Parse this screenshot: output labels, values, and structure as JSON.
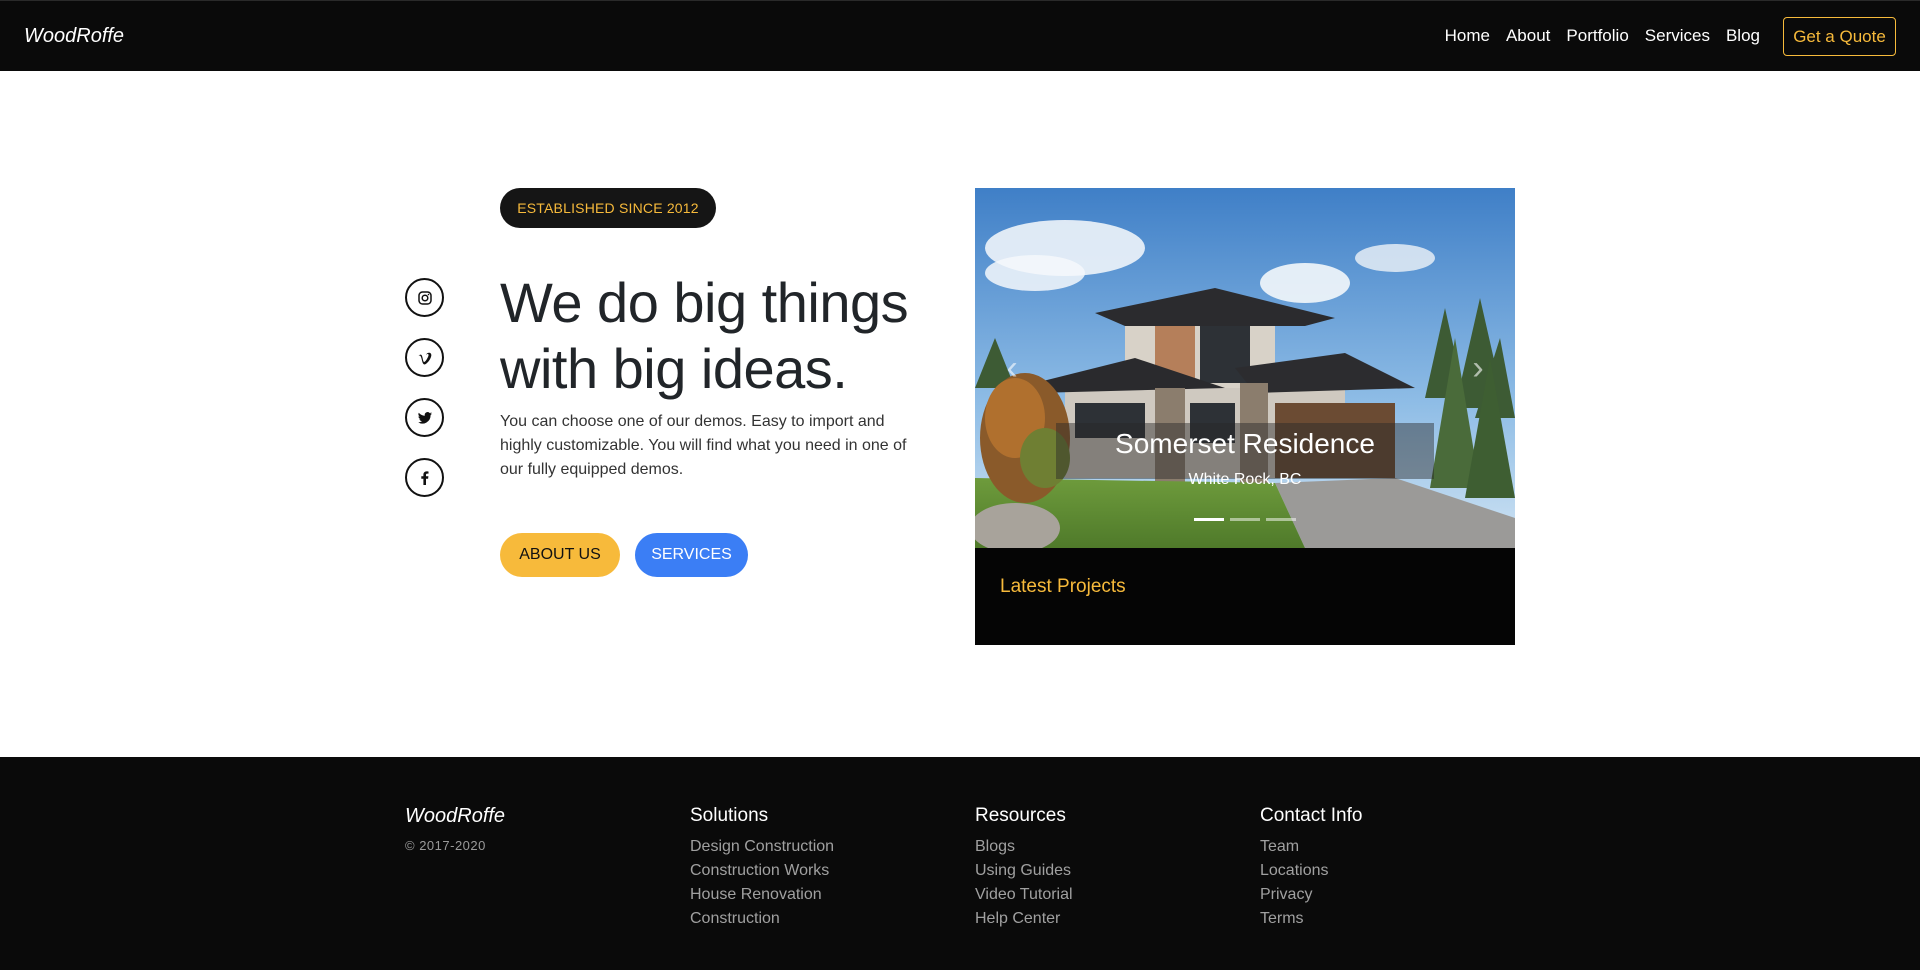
{
  "navbar": {
    "brand": "WoodRoffe",
    "links": [
      "Home",
      "About",
      "Portfolio",
      "Services",
      "Blog"
    ],
    "cta": "Get a Quote"
  },
  "social": [
    "instagram-icon",
    "vimeo-icon",
    "twitter-icon",
    "facebook-icon"
  ],
  "hero": {
    "badge": "ESTABLISHED SINCE 2012",
    "headline_line1": "We do big things",
    "headline_line2": "with big ideas.",
    "lead": "You can choose one of our demos. Easy to import and highly customizable. You will find what you need in one of our fully equipped demos.",
    "about_button": "ABOUT US",
    "services_button": "SERVICES"
  },
  "carousel": {
    "title": "Somerset Residence",
    "subtitle": "White Rock, BC",
    "slide_count": 3,
    "active_slide": 1,
    "section_title": "Latest Projects"
  },
  "footer": {
    "brand": "WoodRoffe",
    "copyright": "© 2017-2020",
    "columns": [
      {
        "title": "Solutions",
        "links": [
          "Design Construction",
          "Construction Works",
          "House Renovation",
          "Construction"
        ]
      },
      {
        "title": "Resources",
        "links": [
          "Blogs",
          "Using Guides",
          "Video Tutorial",
          "Help Center"
        ]
      },
      {
        "title": "Contact Info",
        "links": [
          "Team",
          "Locations",
          "Privacy",
          "Terms"
        ]
      }
    ]
  },
  "colors": {
    "accent": "#f7ba3b",
    "primary_blue": "#3b7ef5",
    "dark": "#0a0a0a"
  }
}
